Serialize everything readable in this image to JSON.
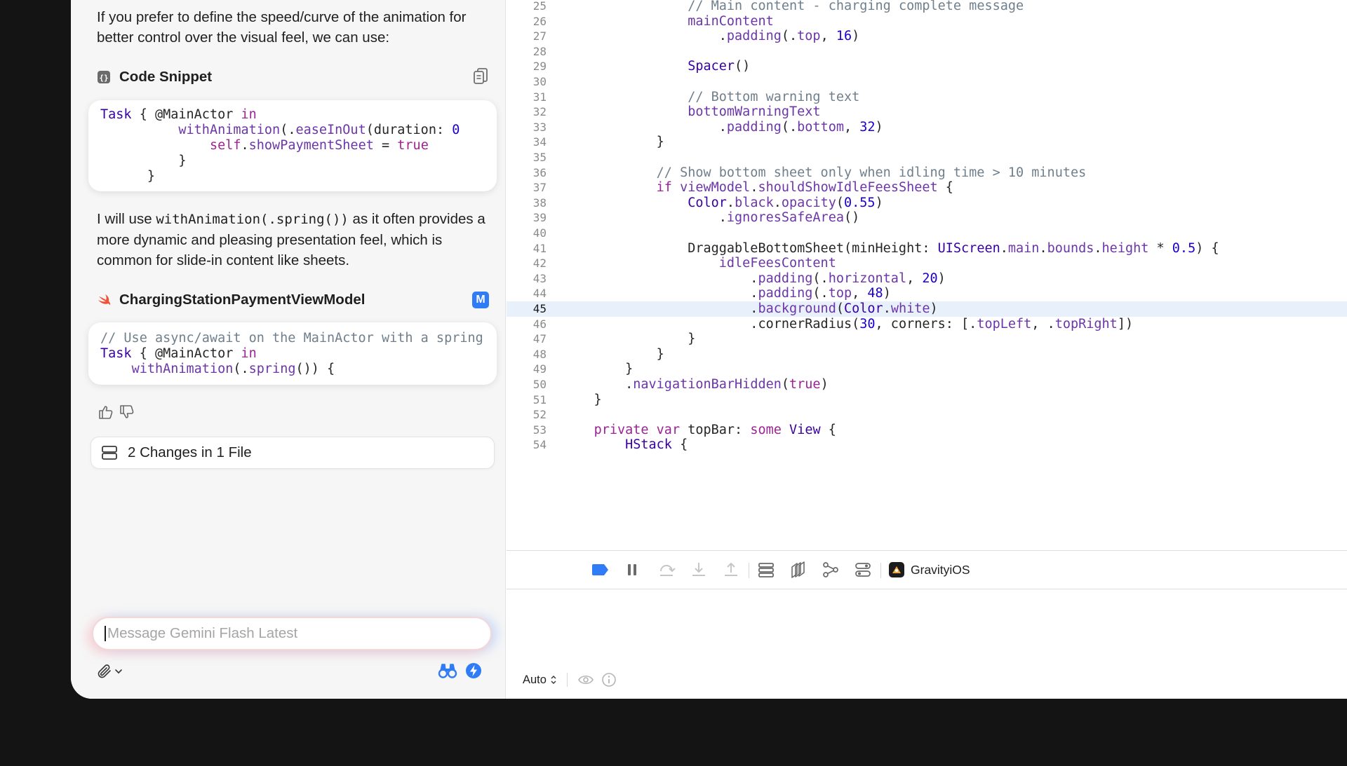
{
  "chat": {
    "intro_text": "If you prefer to define the speed/curve of the animation for better control over the visual feel, we can use:",
    "snippet_title": "Code Snippet",
    "snippet_lines": [
      [
        [
          "ty",
          "Task"
        ],
        [
          "pl",
          " { @MainActor "
        ],
        [
          "kw",
          "in"
        ]
      ],
      [
        [
          "pl",
          "          "
        ],
        [
          "fn",
          "withAnimation"
        ],
        [
          "pl",
          "(."
        ],
        [
          "fn",
          "easeInOut"
        ],
        [
          "pl",
          "(duration: "
        ],
        [
          "num",
          "0"
        ]
      ],
      [
        [
          "pl",
          "              "
        ],
        [
          "kw",
          "self"
        ],
        [
          "pl",
          "."
        ],
        [
          "fn",
          "showPaymentSheet"
        ],
        [
          "pl",
          " = "
        ],
        [
          "kw",
          "true"
        ]
      ],
      [
        [
          "pl",
          "          }"
        ]
      ],
      [
        [
          "pl",
          "      }"
        ]
      ]
    ],
    "explain_pre": "I will use ",
    "explain_code": "withAnimation(.spring())",
    "explain_post": " as it often provides a more dynamic and pleasing presentation feel, which is common for slide-in content like sheets.",
    "file_title": "ChargingStationPaymentViewModel",
    "file_badge": "M",
    "file_lines": [
      [
        [
          "cm",
          "// Use async/await on the MainActor with a spring"
        ]
      ],
      [
        [
          "ty",
          "Task"
        ],
        [
          "pl",
          " { @MainActor "
        ],
        [
          "kw",
          "in"
        ]
      ],
      [
        [
          "pl",
          "    "
        ],
        [
          "fn",
          "withAnimation"
        ],
        [
          "pl",
          "(."
        ],
        [
          "fn",
          "spring"
        ],
        [
          "pl",
          "()) {"
        ]
      ]
    ],
    "changes_label": "2 Changes in 1 File",
    "message_placeholder": "Message Gemini Flash Latest"
  },
  "editor": {
    "highlighted_line": 45,
    "lines": [
      {
        "n": "25",
        "t": [
          [
            "pl",
            "                "
          ],
          [
            "cm",
            "// Main content - charging complete message"
          ]
        ]
      },
      {
        "n": "26",
        "t": [
          [
            "pl",
            "                "
          ],
          [
            "fn",
            "mainContent"
          ]
        ]
      },
      {
        "n": "27",
        "t": [
          [
            "pl",
            "                    ."
          ],
          [
            "fn",
            "padding"
          ],
          [
            "pl",
            "(."
          ],
          [
            "fn",
            "top"
          ],
          [
            "pl",
            ", "
          ],
          [
            "num",
            "16"
          ],
          [
            "pl",
            ")"
          ]
        ]
      },
      {
        "n": "28",
        "t": []
      },
      {
        "n": "29",
        "t": [
          [
            "pl",
            "                "
          ],
          [
            "ty",
            "Spacer"
          ],
          [
            "pl",
            "()"
          ]
        ]
      },
      {
        "n": "30",
        "t": []
      },
      {
        "n": "31",
        "t": [
          [
            "pl",
            "                "
          ],
          [
            "cm",
            "// Bottom warning text"
          ]
        ]
      },
      {
        "n": "32",
        "t": [
          [
            "pl",
            "                "
          ],
          [
            "fn",
            "bottomWarningText"
          ]
        ]
      },
      {
        "n": "33",
        "t": [
          [
            "pl",
            "                    ."
          ],
          [
            "fn",
            "padding"
          ],
          [
            "pl",
            "(."
          ],
          [
            "fn",
            "bottom"
          ],
          [
            "pl",
            ", "
          ],
          [
            "num",
            "32"
          ],
          [
            "pl",
            ")"
          ]
        ]
      },
      {
        "n": "34",
        "t": [
          [
            "pl",
            "            }"
          ]
        ]
      },
      {
        "n": "35",
        "t": []
      },
      {
        "n": "36",
        "t": [
          [
            "pl",
            "            "
          ],
          [
            "cm",
            "// Show bottom sheet only when idling time > 10 minutes"
          ]
        ]
      },
      {
        "n": "37",
        "t": [
          [
            "pl",
            "            "
          ],
          [
            "kw",
            "if"
          ],
          [
            "pl",
            " "
          ],
          [
            "fn",
            "viewModel"
          ],
          [
            "pl",
            "."
          ],
          [
            "fn",
            "shouldShowIdleFeesSheet"
          ],
          [
            "pl",
            " {"
          ]
        ]
      },
      {
        "n": "38",
        "t": [
          [
            "pl",
            "                "
          ],
          [
            "ty",
            "Color"
          ],
          [
            "pl",
            "."
          ],
          [
            "fn",
            "black"
          ],
          [
            "pl",
            "."
          ],
          [
            "fn",
            "opacity"
          ],
          [
            "pl",
            "("
          ],
          [
            "num",
            "0.55"
          ],
          [
            "pl",
            ")"
          ]
        ]
      },
      {
        "n": "39",
        "t": [
          [
            "pl",
            "                    ."
          ],
          [
            "fn",
            "ignoresSafeArea"
          ],
          [
            "pl",
            "()"
          ]
        ]
      },
      {
        "n": "40",
        "t": []
      },
      {
        "n": "41",
        "t": [
          [
            "pl",
            "                DraggableBottomSheet(minHeight: "
          ],
          [
            "ty",
            "UIScreen"
          ],
          [
            "pl",
            "."
          ],
          [
            "fn",
            "main"
          ],
          [
            "pl",
            "."
          ],
          [
            "fn",
            "bounds"
          ],
          [
            "pl",
            "."
          ],
          [
            "fn",
            "height"
          ],
          [
            "pl",
            " * "
          ],
          [
            "num",
            "0.5"
          ],
          [
            "pl",
            ") {"
          ]
        ]
      },
      {
        "n": "42",
        "t": [
          [
            "pl",
            "                    "
          ],
          [
            "fn",
            "idleFeesContent"
          ]
        ]
      },
      {
        "n": "43",
        "t": [
          [
            "pl",
            "                        ."
          ],
          [
            "fn",
            "padding"
          ],
          [
            "pl",
            "(."
          ],
          [
            "fn",
            "horizontal"
          ],
          [
            "pl",
            ", "
          ],
          [
            "num",
            "20"
          ],
          [
            "pl",
            ")"
          ]
        ]
      },
      {
        "n": "44",
        "t": [
          [
            "pl",
            "                        ."
          ],
          [
            "fn",
            "padding"
          ],
          [
            "pl",
            "(."
          ],
          [
            "fn",
            "top"
          ],
          [
            "pl",
            ", "
          ],
          [
            "num",
            "48"
          ],
          [
            "pl",
            ")"
          ]
        ]
      },
      {
        "n": "45",
        "t": [
          [
            "pl",
            "                        ."
          ],
          [
            "fn",
            "background"
          ],
          [
            "pl",
            "("
          ],
          [
            "ty",
            "Color"
          ],
          [
            "pl",
            "."
          ],
          [
            "fn",
            "white"
          ],
          [
            "pl",
            ")"
          ]
        ]
      },
      {
        "n": "46",
        "t": [
          [
            "pl",
            "                        .cornerRadius("
          ],
          [
            "num",
            "30"
          ],
          [
            "pl",
            ", corners: [."
          ],
          [
            "fn",
            "topLeft"
          ],
          [
            "pl",
            ", ."
          ],
          [
            "fn",
            "topRight"
          ],
          [
            "pl",
            "])"
          ]
        ]
      },
      {
        "n": "47",
        "t": [
          [
            "pl",
            "                }"
          ]
        ]
      },
      {
        "n": "48",
        "t": [
          [
            "pl",
            "            }"
          ]
        ]
      },
      {
        "n": "49",
        "t": [
          [
            "pl",
            "        }"
          ]
        ]
      },
      {
        "n": "50",
        "t": [
          [
            "pl",
            "        ."
          ],
          [
            "fn",
            "navigationBarHidden"
          ],
          [
            "pl",
            "("
          ],
          [
            "kw",
            "true"
          ],
          [
            "pl",
            ")"
          ]
        ]
      },
      {
        "n": "51",
        "t": [
          [
            "pl",
            "    }"
          ]
        ]
      },
      {
        "n": "52",
        "t": []
      },
      {
        "n": "53",
        "t": [
          [
            "pl",
            "    "
          ],
          [
            "kw",
            "private var"
          ],
          [
            "pl",
            " topBar: "
          ],
          [
            "kw",
            "some"
          ],
          [
            "pl",
            " "
          ],
          [
            "ty",
            "View"
          ],
          [
            "pl",
            " {"
          ]
        ]
      },
      {
        "n": "54",
        "t": [
          [
            "pl",
            "        "
          ],
          [
            "ty",
            "HStack"
          ],
          [
            "pl",
            " {"
          ]
        ]
      }
    ]
  },
  "debugbar": {
    "scheme_label": "GravityiOS"
  },
  "console": {
    "filter_label": "Auto"
  },
  "colors": {
    "accent_blue": "#2f7cf6",
    "keyword": "#9b2393",
    "type": "#3900a0",
    "function": "#6c36a9",
    "number": "#1c00cf",
    "comment": "#707f8c"
  }
}
